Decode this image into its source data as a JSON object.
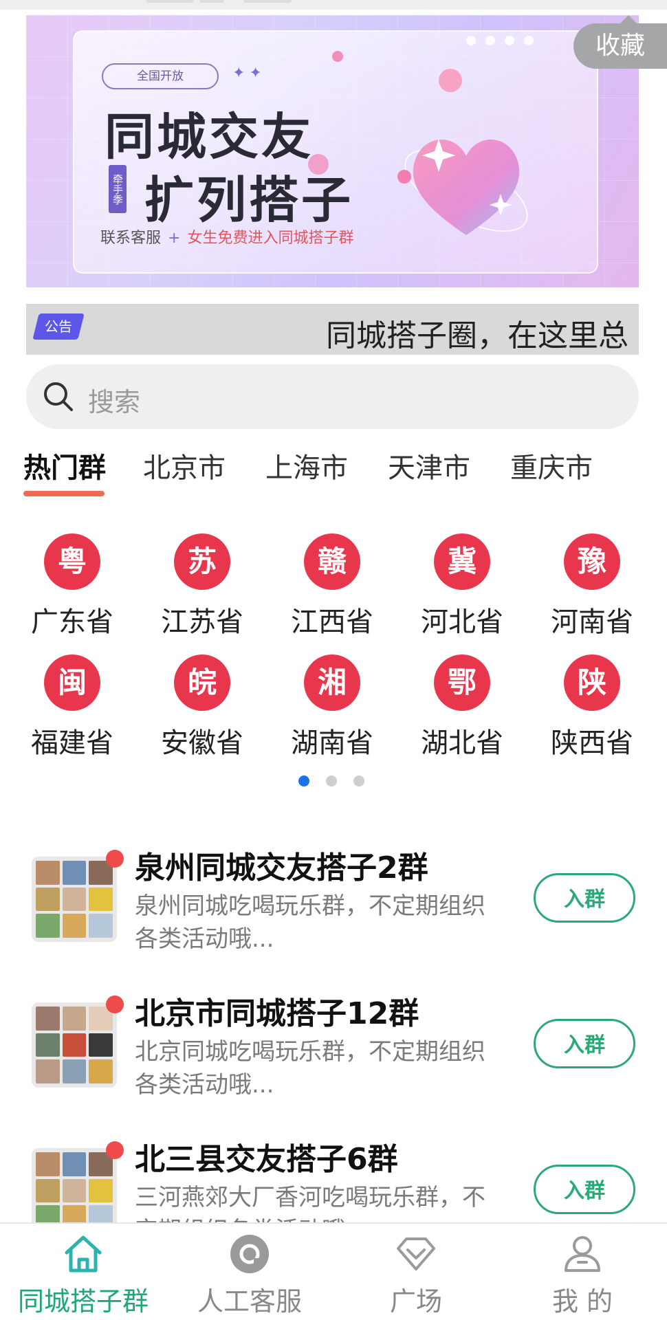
{
  "banner": {
    "pill": "全国开放",
    "title_line1": "同城交友",
    "title_line2": "扩列搭子",
    "vertical_tag": "牵手季",
    "sub_left": "联系客服",
    "sub_sep": "+",
    "sub_right": "女生免费进入同城搭子群",
    "collect_label": "收藏"
  },
  "notice": {
    "tag": "公告",
    "text": "同城搭子圈，在这里总"
  },
  "search": {
    "placeholder": "搜索",
    "icon": "search-icon"
  },
  "tabs": [
    {
      "label": "热门群",
      "active": true
    },
    {
      "label": "北京市"
    },
    {
      "label": "上海市"
    },
    {
      "label": "天津市"
    },
    {
      "label": "重庆市"
    }
  ],
  "provinces": [
    {
      "abbr": "粤",
      "name": "广东省"
    },
    {
      "abbr": "苏",
      "name": "江苏省"
    },
    {
      "abbr": "赣",
      "name": "江西省"
    },
    {
      "abbr": "冀",
      "name": "河北省"
    },
    {
      "abbr": "豫",
      "name": "河南省"
    },
    {
      "abbr": "闽",
      "name": "福建省"
    },
    {
      "abbr": "皖",
      "name": "安徽省"
    },
    {
      "abbr": "湘",
      "name": "湖南省"
    },
    {
      "abbr": "鄂",
      "name": "湖北省"
    },
    {
      "abbr": "陕",
      "name": "陕西省"
    }
  ],
  "pager": {
    "count": 3,
    "active_index": 0
  },
  "groups": [
    {
      "name": "泉州同城交友搭子2群",
      "desc": "泉州同城吃喝玩乐群，不定期组织各类活动哦...",
      "button": "入群"
    },
    {
      "name": "北京市同城搭子12群",
      "desc": "北京同城吃喝玩乐群，不定期组织各类活动哦...",
      "button": "入群"
    },
    {
      "name": "北三县交友搭子6群",
      "desc": "三河燕郊大厂香河吃喝玩乐群，不定期组织各类活动哦...",
      "button": "入群"
    }
  ],
  "bottom_nav": [
    {
      "label": "同城搭子群",
      "icon": "home-icon",
      "active": true
    },
    {
      "label": "人工客服",
      "icon": "customer-service-icon"
    },
    {
      "label": "广场",
      "icon": "plaza-icon"
    },
    {
      "label": "我 的",
      "icon": "user-icon"
    }
  ],
  "colors": {
    "accent_green": "#20a67a",
    "join_green": "#2aa876",
    "province_red": "#e8374d",
    "tab_underline": "#f26b4f",
    "notice_tag": "#5e56e8"
  }
}
